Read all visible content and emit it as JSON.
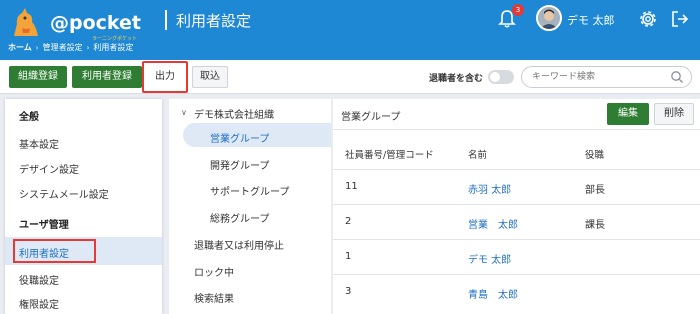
{
  "header": {
    "logo_text": "@pocket",
    "logo_sub": "ラーニングポケット",
    "page_title": "利用者設定",
    "notification_count": "3",
    "user_name": "デモ 太郎",
    "brand_color": "#1e88d4"
  },
  "breadcrumb": [
    "ホーム",
    "管理者設定",
    "利用者設定"
  ],
  "toolbar": {
    "org_register": "組織登録",
    "user_register": "利用者登録",
    "export": "出力",
    "import": "取込",
    "include_retired": "退職者を含む",
    "search_placeholder": "キーワード検索"
  },
  "leftnav": {
    "general_heading": "全般",
    "general_items": [
      "基本設定",
      "デザイン設定",
      "システムメール設定"
    ],
    "user_heading": "ユーザ管理",
    "user_items": [
      "利用者設定",
      "役職設定",
      "権限設定"
    ]
  },
  "tree": {
    "root": "デモ株式会社組織",
    "groups": [
      "営業グループ",
      "開発グループ",
      "サポートグループ",
      "総務グループ"
    ],
    "others": [
      "退職者又は利用停止",
      "ロック中",
      "検索結果"
    ]
  },
  "main": {
    "group_title": "営業グループ",
    "edit": "編集",
    "delete": "削除",
    "columns": [
      "社員番号/管理コード",
      "名前",
      "役職"
    ],
    "rows": [
      {
        "id": "11",
        "name": "赤羽 太郎",
        "role": "部長"
      },
      {
        "id": "2",
        "name": "営業　太郎",
        "role": "課長"
      },
      {
        "id": "1",
        "name": "デモ 太郎",
        "role": ""
      },
      {
        "id": "3",
        "name": "青島　太郎",
        "role": ""
      }
    ]
  }
}
